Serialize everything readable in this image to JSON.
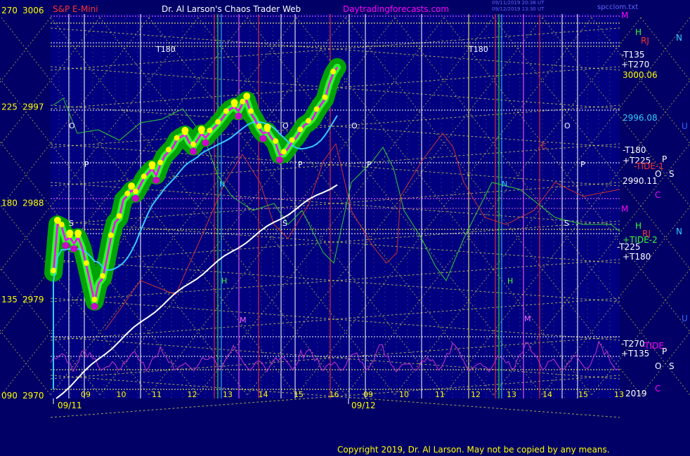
{
  "header": {
    "instrument": "S&P E-Mini",
    "site": "Dr. Al Larson's Chaos Trader Web",
    "url": "Daytradingforecasts.com",
    "stamp1": "09/11/2019 20:38 UT",
    "stamp2": "09/12/2019 13:30 UT",
    "filename": "spcclom.txt"
  },
  "copyright": "Copyright 2019, Dr. Al Larson. May not be copied by any means.",
  "colors": {
    "background": "#000066",
    "plot_bg": "#000080",
    "price": "#ff00ff",
    "glow_outer": "#00aa00",
    "glow_mid": "#33ff33",
    "dots": "#ffff00",
    "cyan_avg": "#33ccff",
    "white_avg": "#ffffff",
    "tide": "#cc3333",
    "green_line": "#33cc33",
    "magenta_osc": "#cc33cc"
  },
  "chart_data": {
    "type": "line",
    "title": "S&P E-Mini",
    "x_date_labels": [
      "09/11",
      "09/12"
    ],
    "x_hour_ticks_day1": [
      "09",
      "10",
      "11",
      "12",
      "13",
      "14",
      "15",
      "16"
    ],
    "x_hour_ticks_day2": [
      "09",
      "10",
      "11",
      "12",
      "13",
      "14",
      "15",
      "13"
    ],
    "y_left_angles": [
      "270",
      "225",
      "180",
      "135",
      "090"
    ],
    "y_left_prices": [
      "3006",
      "2997",
      "2988",
      "2979",
      "2970"
    ],
    "ylim": [
      2970,
      3006
    ],
    "right_labels": [
      {
        "text": "M",
        "color": "#ff00ff"
      },
      {
        "text": "H",
        "color": "#33ff33"
      },
      {
        "text": "RJ",
        "color": "#ff3333"
      },
      {
        "text": "N",
        "color": "#33ccff"
      },
      {
        "text": "-T135",
        "color": "#ffffff"
      },
      {
        "text": "+T270",
        "color": "#ffffff"
      },
      {
        "text": "3000.06",
        "color": "#ffff00"
      },
      {
        "text": "2996.08",
        "color": "#33ccff"
      },
      {
        "text": "U",
        "color": "#3366ff"
      },
      {
        "text": "-T180",
        "color": "#ffffff"
      },
      {
        "text": "+T225",
        "color": "#ffffff"
      },
      {
        "text": "P",
        "color": "#ffffff"
      },
      {
        "text": "-TIDE-1",
        "color": "#ff3333"
      },
      {
        "text": "O",
        "color": "#ffffff"
      },
      {
        "text": "S",
        "color": "#ffffff"
      },
      {
        "text": "2990.11",
        "color": "#ffffff"
      },
      {
        "text": "C",
        "color": "#ff00ff"
      },
      {
        "text": "M",
        "color": "#ff00ff"
      },
      {
        "text": "H",
        "color": "#33ff33"
      },
      {
        "text": "RJ",
        "color": "#ff3333"
      },
      {
        "text": "N",
        "color": "#33ccff"
      },
      {
        "text": "+TIDE-2",
        "color": "#33ff33"
      },
      {
        "text": "-T225",
        "color": "#ffffff"
      },
      {
        "text": "+T180",
        "color": "#ffffff"
      },
      {
        "text": "U",
        "color": "#3366ff"
      },
      {
        "text": "-T270",
        "color": "#ffffff"
      },
      {
        "text": "-TIDE",
        "color": "#ff00ff"
      },
      {
        "text": "+T135",
        "color": "#ffffff"
      },
      {
        "text": "P",
        "color": "#ffffff"
      },
      {
        "text": "O",
        "color": "#ffffff"
      },
      {
        "text": "S",
        "color": "#ffffff"
      },
      {
        "text": "2019",
        "color": "#ffffff"
      },
      {
        "text": "C",
        "color": "#ff00ff"
      }
    ],
    "annotations": [
      "T180",
      "T180",
      "O",
      "O",
      "O",
      "O",
      "P",
      "P",
      "P",
      "P",
      "S",
      "S",
      "S",
      "N",
      "N",
      "H",
      "H",
      "M",
      "M",
      "C"
    ],
    "series": [
      {
        "name": "price",
        "color": "#ff00ff",
        "values": [
          2981.5,
          2986,
          2985.8,
          2984.5,
          2984.8,
          2984.2,
          2984.8,
          2983.8,
          2982.2,
          2980.5,
          2978.8,
          2980.5,
          2981,
          2982.8,
          2984.8,
          2986.2,
          2986.6,
          2988.3,
          2988.7,
          2989.2,
          2988.9,
          2989.6,
          2990.3,
          2990.8,
          2991.2,
          2990.6,
          2991.6,
          2992.4,
          2992.8,
          2993.2,
          2993.9,
          2994.2,
          2994.4,
          2993.7,
          2993.3,
          2993.9,
          2994.5,
          2994.1,
          2994.6,
          2995,
          2995.4,
          2995.9,
          2996.4,
          2996.8,
          2997,
          2996.6,
          2997.3,
          2997.6,
          2996.4,
          2995.8,
          2995,
          2994.5,
          2994.7,
          2994.1,
          2993.6,
          2992.5,
          2992.6,
          2993.1,
          2993.7,
          2994.1,
          2994.7,
          2995.3,
          2995.5,
          2995.9,
          2996.6,
          2997.2,
          2997.7,
          2999.1,
          3000.1,
          3000.7
        ]
      }
    ]
  }
}
